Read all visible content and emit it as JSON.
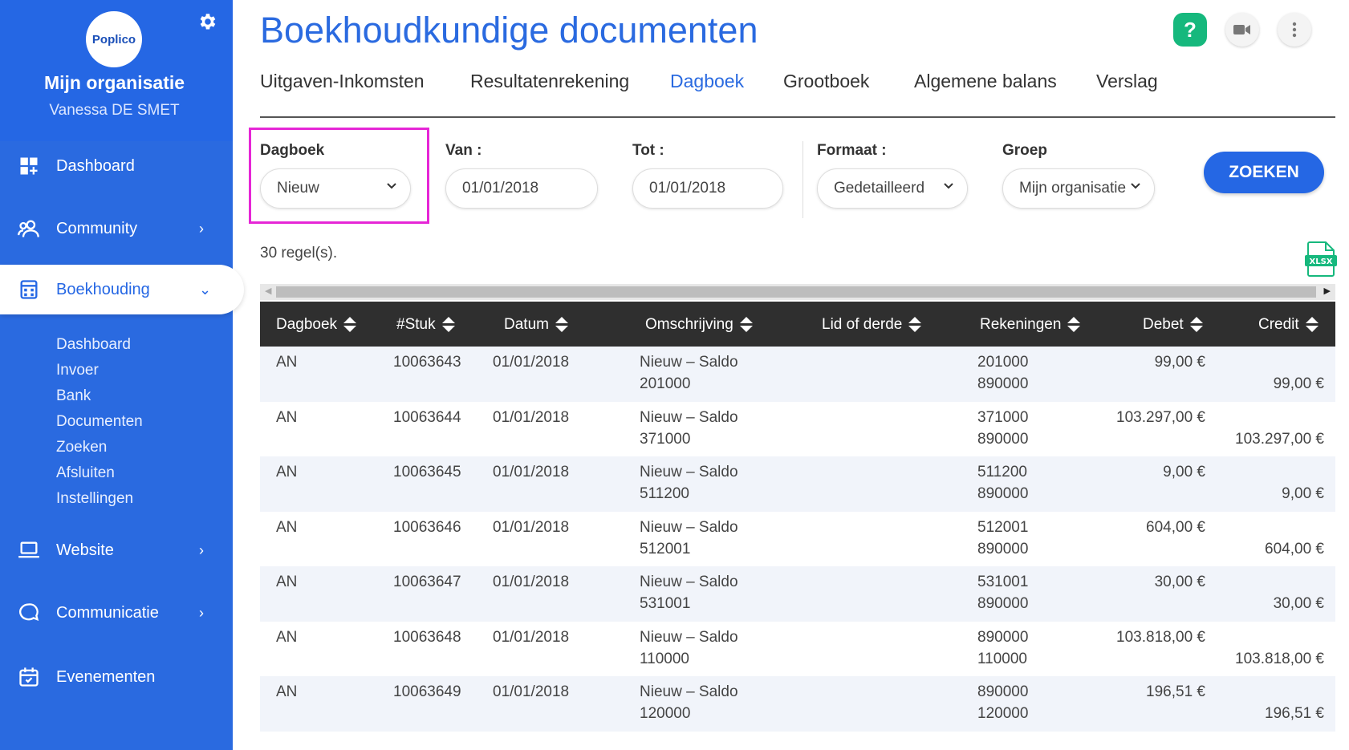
{
  "sidebar": {
    "logo_text": "Poplico",
    "org_name": "Mijn organisatie",
    "user_name": "Vanessa DE SMET",
    "items": [
      {
        "label": "Dashboard",
        "icon": "dashboard-icon"
      },
      {
        "label": "Community",
        "icon": "community-icon"
      },
      {
        "label": "Boekhouding",
        "icon": "calculator-icon"
      },
      {
        "label": "Website",
        "icon": "laptop-icon"
      },
      {
        "label": "Communicatie",
        "icon": "chat-icon"
      },
      {
        "label": "Evenementen",
        "icon": "calendar-icon"
      }
    ],
    "sub_items": [
      "Dashboard",
      "Invoer",
      "Bank",
      "Documenten",
      "Zoeken",
      "Afsluiten",
      "Instellingen"
    ]
  },
  "header": {
    "title": "Boekhoudkundige documenten",
    "help_label": "?"
  },
  "tabs": [
    "Uitgaven-Inkomsten",
    "Resultatenrekening",
    "Dagboek",
    "Grootboek",
    "Algemene balans",
    "Verslag"
  ],
  "filters": {
    "dagboek_label": "Dagboek",
    "dagboek_value": "Nieuw",
    "van_label": "Van :",
    "van_value": "01/01/2018",
    "tot_label": "Tot :",
    "tot_value": "01/01/2018",
    "formaat_label": "Formaat :",
    "formaat_value": "Gedetailleerd",
    "groep_label": "Groep",
    "groep_value": "Mijn organisatie",
    "search_label": "ZOEKEN"
  },
  "results": {
    "count_text": "30 regel(s).",
    "export_label": "XLSX"
  },
  "table": {
    "columns": [
      "Dagboek",
      "#Stuk",
      "Datum",
      "Omschrijving",
      "Lid of derde",
      "Rekeningen",
      "Debet",
      "Credit"
    ],
    "rows": [
      {
        "dagboek": "AN",
        "stuk": "10063643",
        "datum": "01/01/2018",
        "oms1": "Nieuw – Saldo",
        "oms2": "201000",
        "rek1": "201000",
        "rek2": "890000",
        "debet": "99,00 €",
        "credit": "99,00 €"
      },
      {
        "dagboek": "AN",
        "stuk": "10063644",
        "datum": "01/01/2018",
        "oms1": "Nieuw – Saldo",
        "oms2": "371000",
        "rek1": "371000",
        "rek2": "890000",
        "debet": "103.297,00 €",
        "credit": "103.297,00 €"
      },
      {
        "dagboek": "AN",
        "stuk": "10063645",
        "datum": "01/01/2018",
        "oms1": "Nieuw – Saldo",
        "oms2": "511200",
        "rek1": "511200",
        "rek2": "890000",
        "debet": "9,00 €",
        "credit": "9,00 €"
      },
      {
        "dagboek": "AN",
        "stuk": "10063646",
        "datum": "01/01/2018",
        "oms1": "Nieuw – Saldo",
        "oms2": "512001",
        "rek1": "512001",
        "rek2": "890000",
        "debet": "604,00 €",
        "credit": "604,00 €"
      },
      {
        "dagboek": "AN",
        "stuk": "10063647",
        "datum": "01/01/2018",
        "oms1": "Nieuw – Saldo",
        "oms2": "531001",
        "rek1": "531001",
        "rek2": "890000",
        "debet": "30,00 €",
        "credit": "30,00 €"
      },
      {
        "dagboek": "AN",
        "stuk": "10063648",
        "datum": "01/01/2018",
        "oms1": "Nieuw – Saldo",
        "oms2": "110000",
        "rek1": "890000",
        "rek2": "110000",
        "debet": "103.818,00 €",
        "credit": "103.818,00 €"
      },
      {
        "dagboek": "AN",
        "stuk": "10063649",
        "datum": "01/01/2018",
        "oms1": "Nieuw – Saldo",
        "oms2": "120000",
        "rek1": "890000",
        "rek2": "120000",
        "debet": "196,51 €",
        "credit": "196,51 €"
      }
    ]
  },
  "colors": {
    "primary": "#2567e4",
    "sidebar": "#2a6ae0",
    "help": "#16b87d",
    "highlight": "#e626d6",
    "table_header": "#2f2f2f"
  }
}
